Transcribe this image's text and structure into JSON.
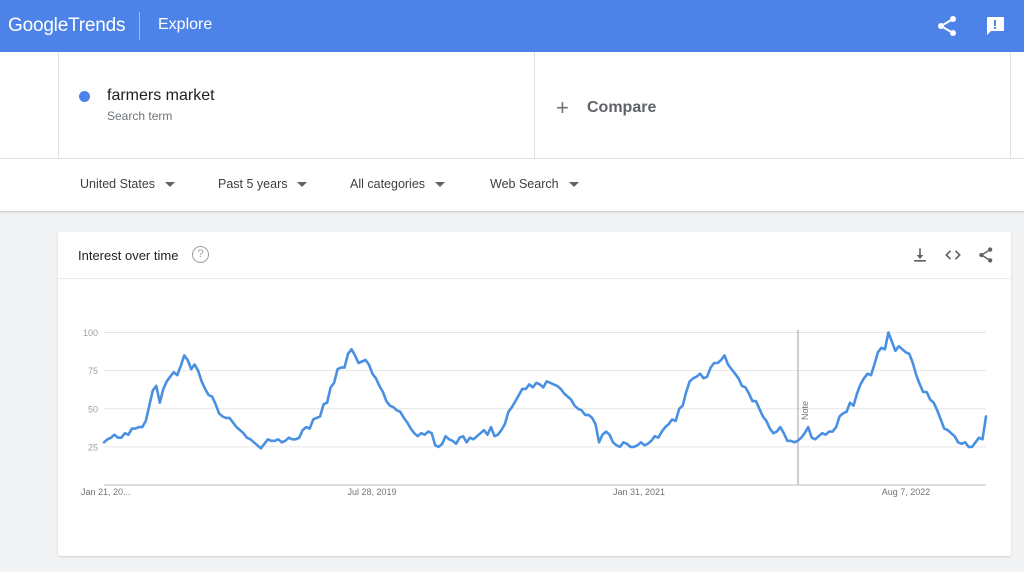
{
  "header": {
    "logo_google": "Google",
    "logo_trends": "Trends",
    "page": "Explore",
    "share_icon": "share-icon",
    "feedback_icon": "feedback-icon",
    "brand_color": "#4d83e8"
  },
  "search": {
    "term": "farmers market",
    "term_type": "Search term",
    "term_color": "#4d83e8",
    "compare_label": "Compare"
  },
  "filters": [
    {
      "label": "United States"
    },
    {
      "label": "Past 5 years"
    },
    {
      "label": "All categories"
    },
    {
      "label": "Web Search"
    }
  ],
  "card": {
    "title": "Interest over time",
    "help_icon": "help-icon",
    "download_icon": "download-icon",
    "embed_icon": "embed-icon",
    "share_icon": "share-icon"
  },
  "chart_data": {
    "type": "line",
    "title": "",
    "xlabel": "",
    "ylabel": "",
    "ylim": [
      0,
      100
    ],
    "yticks": [
      25,
      50,
      75,
      100
    ],
    "xticks": [
      "Jan 21, 20...",
      "Jul 28, 2019",
      "Jan 31, 2021",
      "Aug 7, 2022"
    ],
    "grid": true,
    "annotation": "Note",
    "series": [
      {
        "color": "#4a90e2",
        "values": [
          28,
          30,
          31,
          33,
          31,
          31,
          34,
          33,
          37,
          37,
          38,
          38,
          42,
          52,
          62,
          65,
          54,
          63,
          68,
          71,
          74,
          72,
          78,
          85,
          82,
          76,
          79,
          75,
          68,
          63,
          59,
          58,
          53,
          47,
          45,
          44,
          44,
          41,
          38,
          36,
          34,
          31,
          30,
          28,
          26,
          24,
          27,
          30,
          29,
          29,
          30,
          28,
          29,
          31,
          30,
          30,
          31,
          36,
          38,
          37,
          43,
          44,
          45,
          53,
          54,
          64,
          67,
          76,
          77,
          77,
          86,
          89,
          85,
          80,
          81,
          82,
          79,
          73,
          70,
          65,
          61,
          55,
          52,
          51,
          49,
          48,
          44,
          41,
          37,
          34,
          32,
          34,
          33,
          35,
          34,
          26,
          25,
          27,
          32,
          30,
          29,
          27,
          31,
          32,
          28,
          31,
          30,
          32,
          34,
          36,
          33,
          38,
          32,
          33,
          36,
          40,
          48,
          51,
          55,
          59,
          63,
          63,
          66,
          64,
          67,
          66,
          64,
          68,
          67,
          66,
          65,
          63,
          60,
          58,
          56,
          52,
          50,
          49,
          46,
          46,
          44,
          40,
          28,
          33,
          35,
          33,
          28,
          26,
          25,
          28,
          27,
          25,
          25,
          26,
          28,
          26,
          27,
          29,
          32,
          31,
          35,
          38,
          40,
          43,
          42,
          50,
          52,
          61,
          68,
          70,
          71,
          73,
          70,
          71,
          77,
          80,
          80,
          82,
          85,
          79,
          76,
          73,
          70,
          65,
          64,
          60,
          55,
          55,
          50,
          45,
          42,
          37,
          34,
          35,
          38,
          34,
          29,
          29,
          28,
          29,
          31,
          34,
          38,
          31,
          30,
          32,
          34,
          33,
          35,
          35,
          38,
          45,
          47,
          48,
          54,
          52,
          60,
          66,
          70,
          73,
          72,
          79,
          87,
          90,
          89,
          100,
          94,
          88,
          91,
          89,
          87,
          86,
          80,
          72,
          66,
          61,
          61,
          56,
          54,
          49,
          43,
          37,
          36,
          34,
          32,
          28,
          27,
          28,
          25,
          25,
          28,
          31,
          30,
          45
        ]
      }
    ]
  }
}
